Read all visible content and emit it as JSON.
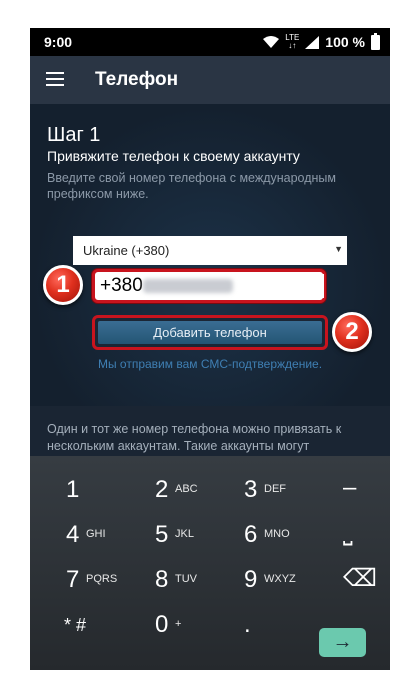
{
  "status_bar": {
    "time": "9:00",
    "network": "LTE",
    "battery": "100 %"
  },
  "app_bar": {
    "title": "Телефон",
    "menu_icon": "hamburger-menu-icon"
  },
  "step": {
    "title": "Шаг 1",
    "subtitle": "Привяжите телефон к своему аккаунту",
    "hint": "Введите свой номер телефона с международным префиксом ниже."
  },
  "country": {
    "selected": "Ukraine (+380)"
  },
  "phone": {
    "value": "+380"
  },
  "add_button": {
    "label": "Добавить телефон"
  },
  "sms_note": "Мы отправим вам СМС-подтверждение.",
  "annotations": {
    "badge1": "1",
    "badge2": "2",
    "badge_color": "#e0301e"
  },
  "info_text": "Один и тот же номер телефона можно привязать к нескольким аккаунтам. Такие аккаунты могут",
  "keyboard": {
    "keys": [
      {
        "digit": "1",
        "letters": ""
      },
      {
        "digit": "2",
        "letters": "ABC"
      },
      {
        "digit": "3",
        "letters": "DEF"
      },
      {
        "digit": "–",
        "letters": ""
      },
      {
        "digit": "4",
        "letters": "GHI"
      },
      {
        "digit": "5",
        "letters": "JKL"
      },
      {
        "digit": "6",
        "letters": "MNO"
      },
      {
        "digit": "⎵",
        "letters": ""
      },
      {
        "digit": "7",
        "letters": "PQRS"
      },
      {
        "digit": "8",
        "letters": "TUV"
      },
      {
        "digit": "9",
        "letters": "WXYZ"
      },
      {
        "digit": "⌫",
        "letters": ""
      },
      {
        "digit": "* #",
        "letters": ""
      },
      {
        "digit": "0",
        "letters": "+"
      },
      {
        "digit": ".",
        "letters": ""
      }
    ],
    "go_symbol": "→",
    "go_color": "#6bc9ae"
  },
  "colors": {
    "accent": "#3f7fb3",
    "highlight": "#c8141e",
    "background": "#1a2533"
  }
}
